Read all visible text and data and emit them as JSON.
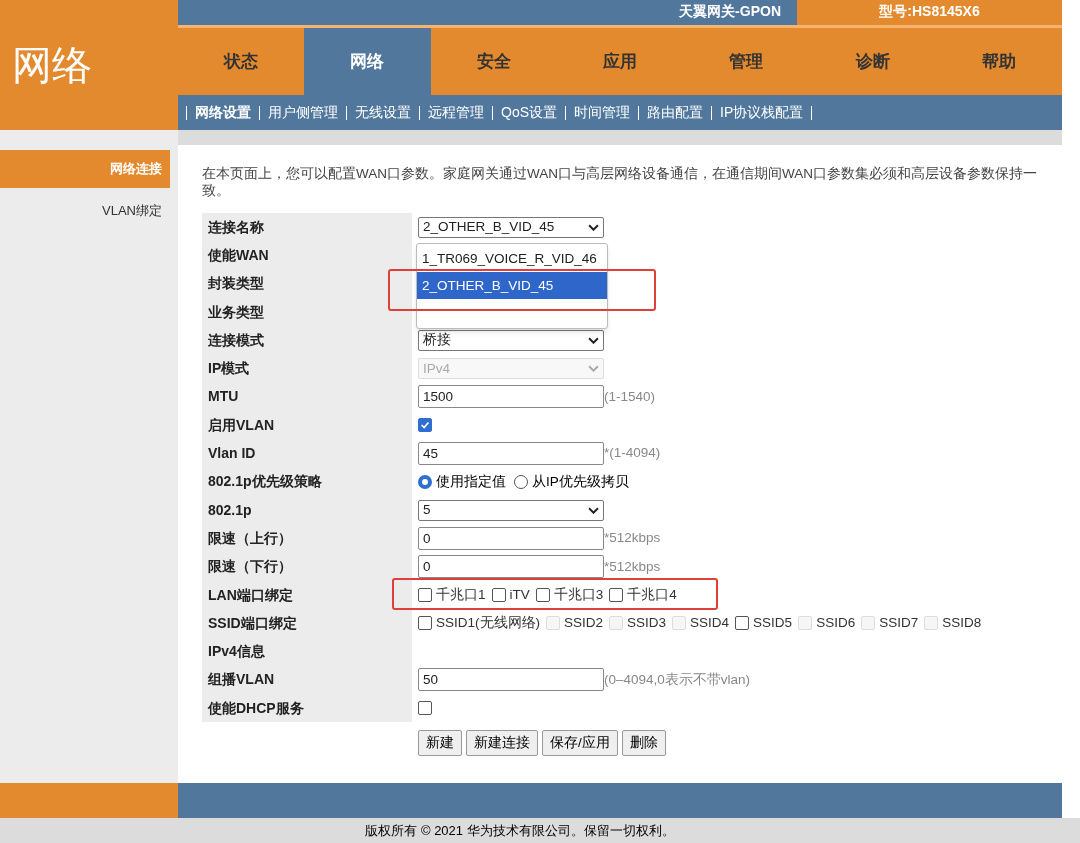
{
  "header": {
    "section_title": "网络",
    "brand": "天翼网关-GPON",
    "model": "型号:HS8145X6"
  },
  "tabs": [
    {
      "label": "状态",
      "selected": false
    },
    {
      "label": "网络",
      "selected": true
    },
    {
      "label": "安全",
      "selected": false
    },
    {
      "label": "应用",
      "selected": false
    },
    {
      "label": "管理",
      "selected": false
    },
    {
      "label": "诊断",
      "selected": false
    },
    {
      "label": "帮助",
      "selected": false
    }
  ],
  "subnav": [
    {
      "label": "网络设置",
      "selected": true
    },
    {
      "label": "用户侧管理",
      "selected": false
    },
    {
      "label": "无线设置",
      "selected": false
    },
    {
      "label": "远程管理",
      "selected": false
    },
    {
      "label": "QoS设置",
      "selected": false
    },
    {
      "label": "时间管理",
      "selected": false
    },
    {
      "label": "路由配置",
      "selected": false
    },
    {
      "label": "IP协议栈配置",
      "selected": false
    }
  ],
  "sidebar": {
    "items": [
      {
        "label": "网络连接",
        "selected": true
      },
      {
        "label": "VLAN绑定",
        "selected": false
      }
    ]
  },
  "intro": "在本页面上，您可以配置WAN口参数。家庭网关通过WAN口与高层网络设备通信，在通信期间WAN口参数集必须和高层设备参数保持一致。",
  "form": {
    "rows": [
      {
        "kind": "select",
        "label": "连接名称",
        "value": "2_OTHER_B_VID_45",
        "disabled": false
      },
      {
        "kind": "covered",
        "label": "使能WAN"
      },
      {
        "kind": "covered",
        "label": "封装类型"
      },
      {
        "kind": "covered",
        "label": "业务类型"
      },
      {
        "kind": "select",
        "label": "连接模式",
        "value": "桥接",
        "disabled": false
      },
      {
        "kind": "select",
        "label": "IP模式",
        "value": "IPv4",
        "disabled": true
      },
      {
        "kind": "text",
        "label": "MTU",
        "value": "1500",
        "hint": "(1-1540)"
      },
      {
        "kind": "checkbox",
        "label": "启用VLAN",
        "checked": true
      },
      {
        "kind": "text",
        "label": "Vlan ID",
        "value": "45",
        "hint": "*(1-4094)"
      },
      {
        "kind": "radio",
        "label": "802.1p优先级策略",
        "options": [
          {
            "label": "使用指定值",
            "selected": true
          },
          {
            "label": "从IP优先级拷贝",
            "selected": false
          }
        ]
      },
      {
        "kind": "select",
        "label": "802.1p",
        "value": "5",
        "disabled": false
      },
      {
        "kind": "text",
        "label": "限速（上行）",
        "value": "0",
        "hint": "*512kbps"
      },
      {
        "kind": "text",
        "label": "限速（下行）",
        "value": "0",
        "hint": "*512kbps"
      },
      {
        "kind": "checks",
        "label": "LAN端口绑定",
        "highlighted": true,
        "options": [
          {
            "label": "千兆口1",
            "checked": false,
            "disabled": false
          },
          {
            "label": "iTV",
            "checked": false,
            "disabled": false
          },
          {
            "label": "千兆口3",
            "checked": false,
            "disabled": false
          },
          {
            "label": "千兆口4",
            "checked": false,
            "disabled": false
          }
        ]
      },
      {
        "kind": "checks",
        "label": "SSID端口绑定",
        "highlighted": false,
        "options": [
          {
            "label": "SSID1(无线网络)",
            "checked": false,
            "disabled": false
          },
          {
            "label": "SSID2",
            "checked": false,
            "disabled": true
          },
          {
            "label": "SSID3",
            "checked": false,
            "disabled": true
          },
          {
            "label": "SSID4",
            "checked": false,
            "disabled": true
          },
          {
            "label": "SSID5",
            "checked": false,
            "disabled": false
          },
          {
            "label": "SSID6",
            "checked": false,
            "disabled": true
          },
          {
            "label": "SSID7",
            "checked": false,
            "disabled": true
          },
          {
            "label": "SSID8",
            "checked": false,
            "disabled": true
          }
        ]
      },
      {
        "kind": "heading",
        "label": "IPv4信息"
      },
      {
        "kind": "text",
        "label": "组播VLAN",
        "value": "50",
        "hint": "(0–4094,0表示不带vlan)"
      },
      {
        "kind": "checkbox",
        "label": "使能DHCP服务",
        "checked": false
      }
    ],
    "dropdown": {
      "highlighted": true,
      "options": [
        {
          "label": "1_TR069_VOICE_R_VID_46",
          "selected": false
        },
        {
          "label": "2_OTHER_B_VID_45",
          "selected": true
        }
      ]
    },
    "buttons": [
      "新建",
      "新建连接",
      "保存/应用",
      "删除"
    ]
  },
  "footer": {
    "copyright": "版权所有 © 2021 华为技术有限公司。保留一切权利。"
  }
}
